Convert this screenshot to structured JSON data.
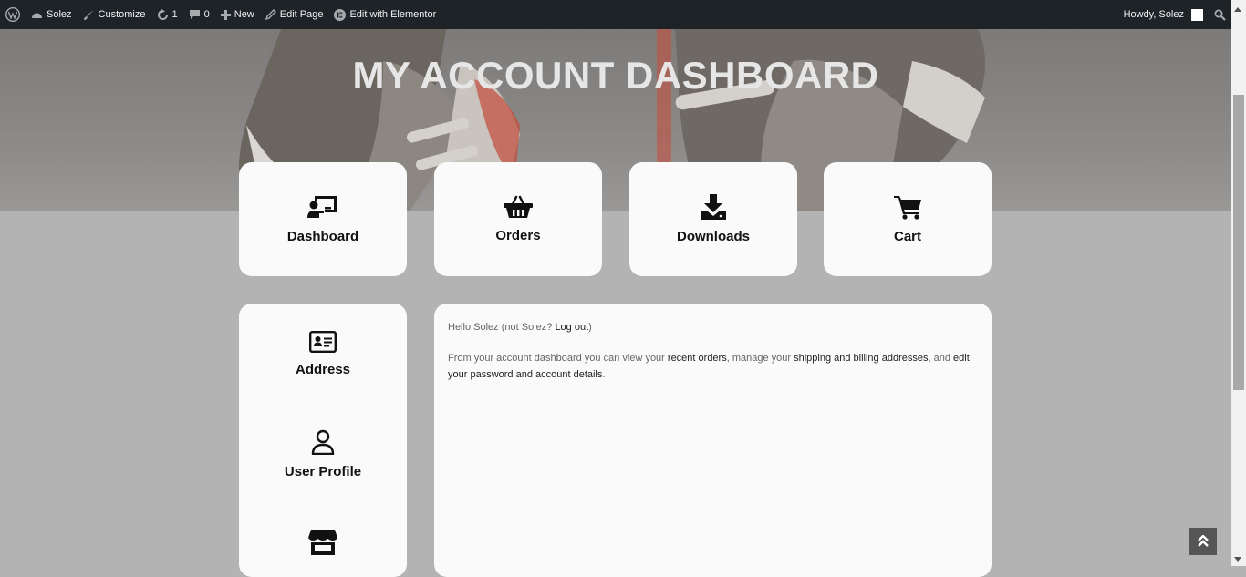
{
  "adminbar": {
    "site_name": "Solez",
    "customize": "Customize",
    "updates_count": "1",
    "comments_count": "0",
    "new_label": "New",
    "edit_page": "Edit Page",
    "elementor": "Edit with Elementor",
    "howdy": "Howdy, Solez"
  },
  "hero": {
    "title": "MY ACCOUNT DASHBOARD"
  },
  "cards": {
    "dashboard": "Dashboard",
    "orders": "Orders",
    "downloads": "Downloads",
    "cart": "Cart"
  },
  "sidebar": {
    "address": "Address",
    "profile": "User Profile"
  },
  "content": {
    "hello": "Hello ",
    "user": "Solez",
    "not_prefix": " (not ",
    "not_user": "Solez? ",
    "logout": "Log out",
    "close_paren": ")",
    "p2_a": "From your account dashboard you can view your ",
    "recent_orders": "recent orders",
    "p2_b": ", manage your ",
    "addresses": "shipping and billing addresses",
    "p2_c": ", and ",
    "edit_pw": "edit your password and account details",
    "p2_d": "."
  },
  "colors": {
    "adminbar": "#1d2327",
    "page_bg": "#b3b3b3",
    "card_bg": "#fafafa"
  }
}
